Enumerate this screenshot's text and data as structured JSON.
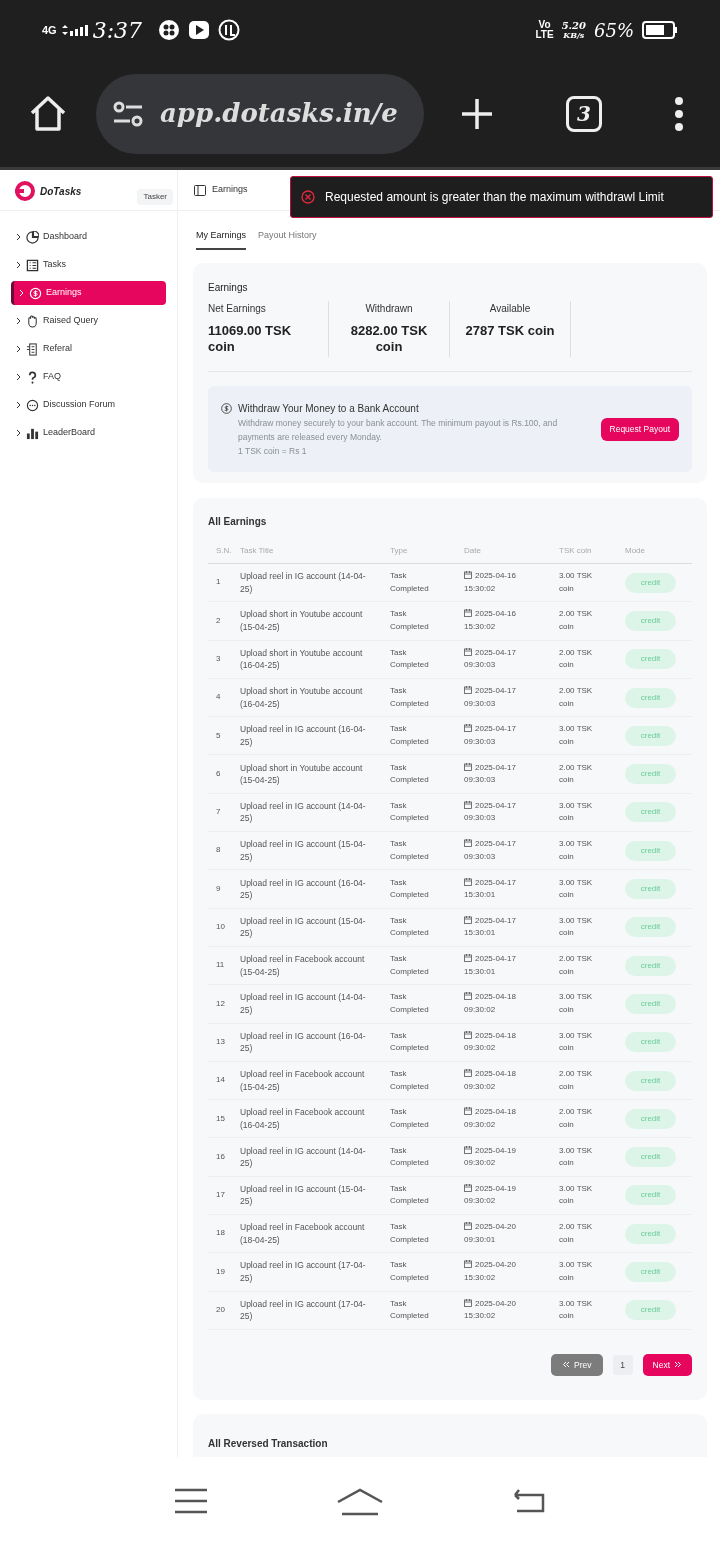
{
  "status_bar": {
    "network": "4G",
    "time": "3:37",
    "volte": "Vo",
    "lte": "LTE",
    "speed": "5.20",
    "speed_unit": "KB/s",
    "battery": "65%"
  },
  "browser": {
    "url": "app.dotasks.in/e",
    "tab_count": "3"
  },
  "app": {
    "brand": "DoTasks",
    "role": "Tasker",
    "page_title": "Earnings"
  },
  "toast": {
    "message": "Requested amount is greater than the maximum withdrawl Limit"
  },
  "sidebar": {
    "items": [
      {
        "label": "Dashboard",
        "selected": false
      },
      {
        "label": "Tasks",
        "selected": false
      },
      {
        "label": "Earnings",
        "selected": true
      },
      {
        "label": "Raised Query",
        "selected": false
      },
      {
        "label": "Referal",
        "selected": false
      },
      {
        "label": "FAQ",
        "selected": false
      },
      {
        "label": "Discussion Forum",
        "selected": false
      },
      {
        "label": "LeaderBoard",
        "selected": false
      }
    ]
  },
  "tabs": [
    {
      "label": "My Earnings",
      "selected": true
    },
    {
      "label": "Payout History",
      "selected": false
    }
  ],
  "summary": {
    "title": "Earnings",
    "stats": [
      {
        "label": "Net Earnings",
        "value": "11069.00 TSK coin"
      },
      {
        "label": "Withdrawn",
        "value": "8282.00 TSK coin"
      },
      {
        "label": "Available",
        "value": "2787 TSK coin"
      }
    ],
    "withdraw": {
      "title": "Withdraw Your Money to a Bank Account",
      "text": "Withdraw money securely to your bank account. The minimum payout is Rs.100, and payments are released every Monday.",
      "rate": "1 TSK coin = Rs 1",
      "button": "Request Payout"
    }
  },
  "table": {
    "title": "All Earnings",
    "columns": [
      "S.N.",
      "Task Title",
      "Type",
      "Date",
      "TSK coin",
      "Mode"
    ],
    "rows": [
      [
        "1",
        "Upload reel in IG account (14-04-25)",
        "Task Completed",
        "2025-04-16 15:30:02",
        "3.00 TSK coin",
        "credit"
      ],
      [
        "2",
        "Upload short in Youtube account (15-04-25)",
        "Task Completed",
        "2025-04-16 15:30:02",
        "2.00 TSK coin",
        "credit"
      ],
      [
        "3",
        "Upload short in Youtube account (16-04-25)",
        "Task Completed",
        "2025-04-17 09:30:03",
        "2.00 TSK coin",
        "credit"
      ],
      [
        "4",
        "Upload short in Youtube account (16-04-25)",
        "Task Completed",
        "2025-04-17 09:30:03",
        "2.00 TSK coin",
        "credit"
      ],
      [
        "5",
        "Upload reel in IG account (16-04-25)",
        "Task Completed",
        "2025-04-17 09:30:03",
        "3.00 TSK coin",
        "credit"
      ],
      [
        "6",
        "Upload short in Youtube account (15-04-25)",
        "Task Completed",
        "2025-04-17 09:30:03",
        "2.00 TSK coin",
        "credit"
      ],
      [
        "7",
        "Upload reel in IG account (14-04-25)",
        "Task Completed",
        "2025-04-17 09:30:03",
        "3.00 TSK coin",
        "credit"
      ],
      [
        "8",
        "Upload reel in IG account (15-04-25)",
        "Task Completed",
        "2025-04-17 09:30:03",
        "3.00 TSK coin",
        "credit"
      ],
      [
        "9",
        "Upload reel in IG account (16-04-25)",
        "Task Completed",
        "2025-04-17 15:30:01",
        "3.00 TSK coin",
        "credit"
      ],
      [
        "10",
        "Upload reel in IG account (15-04-25)",
        "Task Completed",
        "2025-04-17 15:30:01",
        "3.00 TSK coin",
        "credit"
      ],
      [
        "11",
        "Upload reel in Facebook account (15-04-25)",
        "Task Completed",
        "2025-04-17 15:30:01",
        "2.00 TSK coin",
        "credit"
      ],
      [
        "12",
        "Upload reel in IG account (14-04-25)",
        "Task Completed",
        "2025-04-18 09:30:02",
        "3.00 TSK coin",
        "credit"
      ],
      [
        "13",
        "Upload reel in IG account (16-04-25)",
        "Task Completed",
        "2025-04-18 09:30:02",
        "3.00 TSK coin",
        "credit"
      ],
      [
        "14",
        "Upload reel in Facebook account (15-04-25)",
        "Task Completed",
        "2025-04-18 09:30:02",
        "2.00 TSK coin",
        "credit"
      ],
      [
        "15",
        "Upload reel in Facebook account (16-04-25)",
        "Task Completed",
        "2025-04-18 09:30:02",
        "2.00 TSK coin",
        "credit"
      ],
      [
        "16",
        "Upload reel in IG account (14-04-25)",
        "Task Completed",
        "2025-04-19 09:30:02",
        "3.00 TSK coin",
        "credit"
      ],
      [
        "17",
        "Upload reel in IG account (15-04-25)",
        "Task Completed",
        "2025-04-19 09:30:02",
        "3.00 TSK coin",
        "credit"
      ],
      [
        "18",
        "Upload reel in Facebook account (18-04-25)",
        "Task Completed",
        "2025-04-20 09:30:01",
        "2.00 TSK coin",
        "credit"
      ],
      [
        "19",
        "Upload reel in IG account (17-04-25)",
        "Task Completed",
        "2025-04-20 15:30:02",
        "3.00 TSK coin",
        "credit"
      ],
      [
        "20",
        "Upload reel in IG account (17-04-25)",
        "Task Completed",
        "2025-04-20 15:30:02",
        "3.00 TSK coin",
        "credit"
      ]
    ],
    "pagination": {
      "prev": "Prev",
      "page": "1",
      "next": "Next"
    }
  },
  "reversed": {
    "title": "All Reversed Transaction"
  }
}
